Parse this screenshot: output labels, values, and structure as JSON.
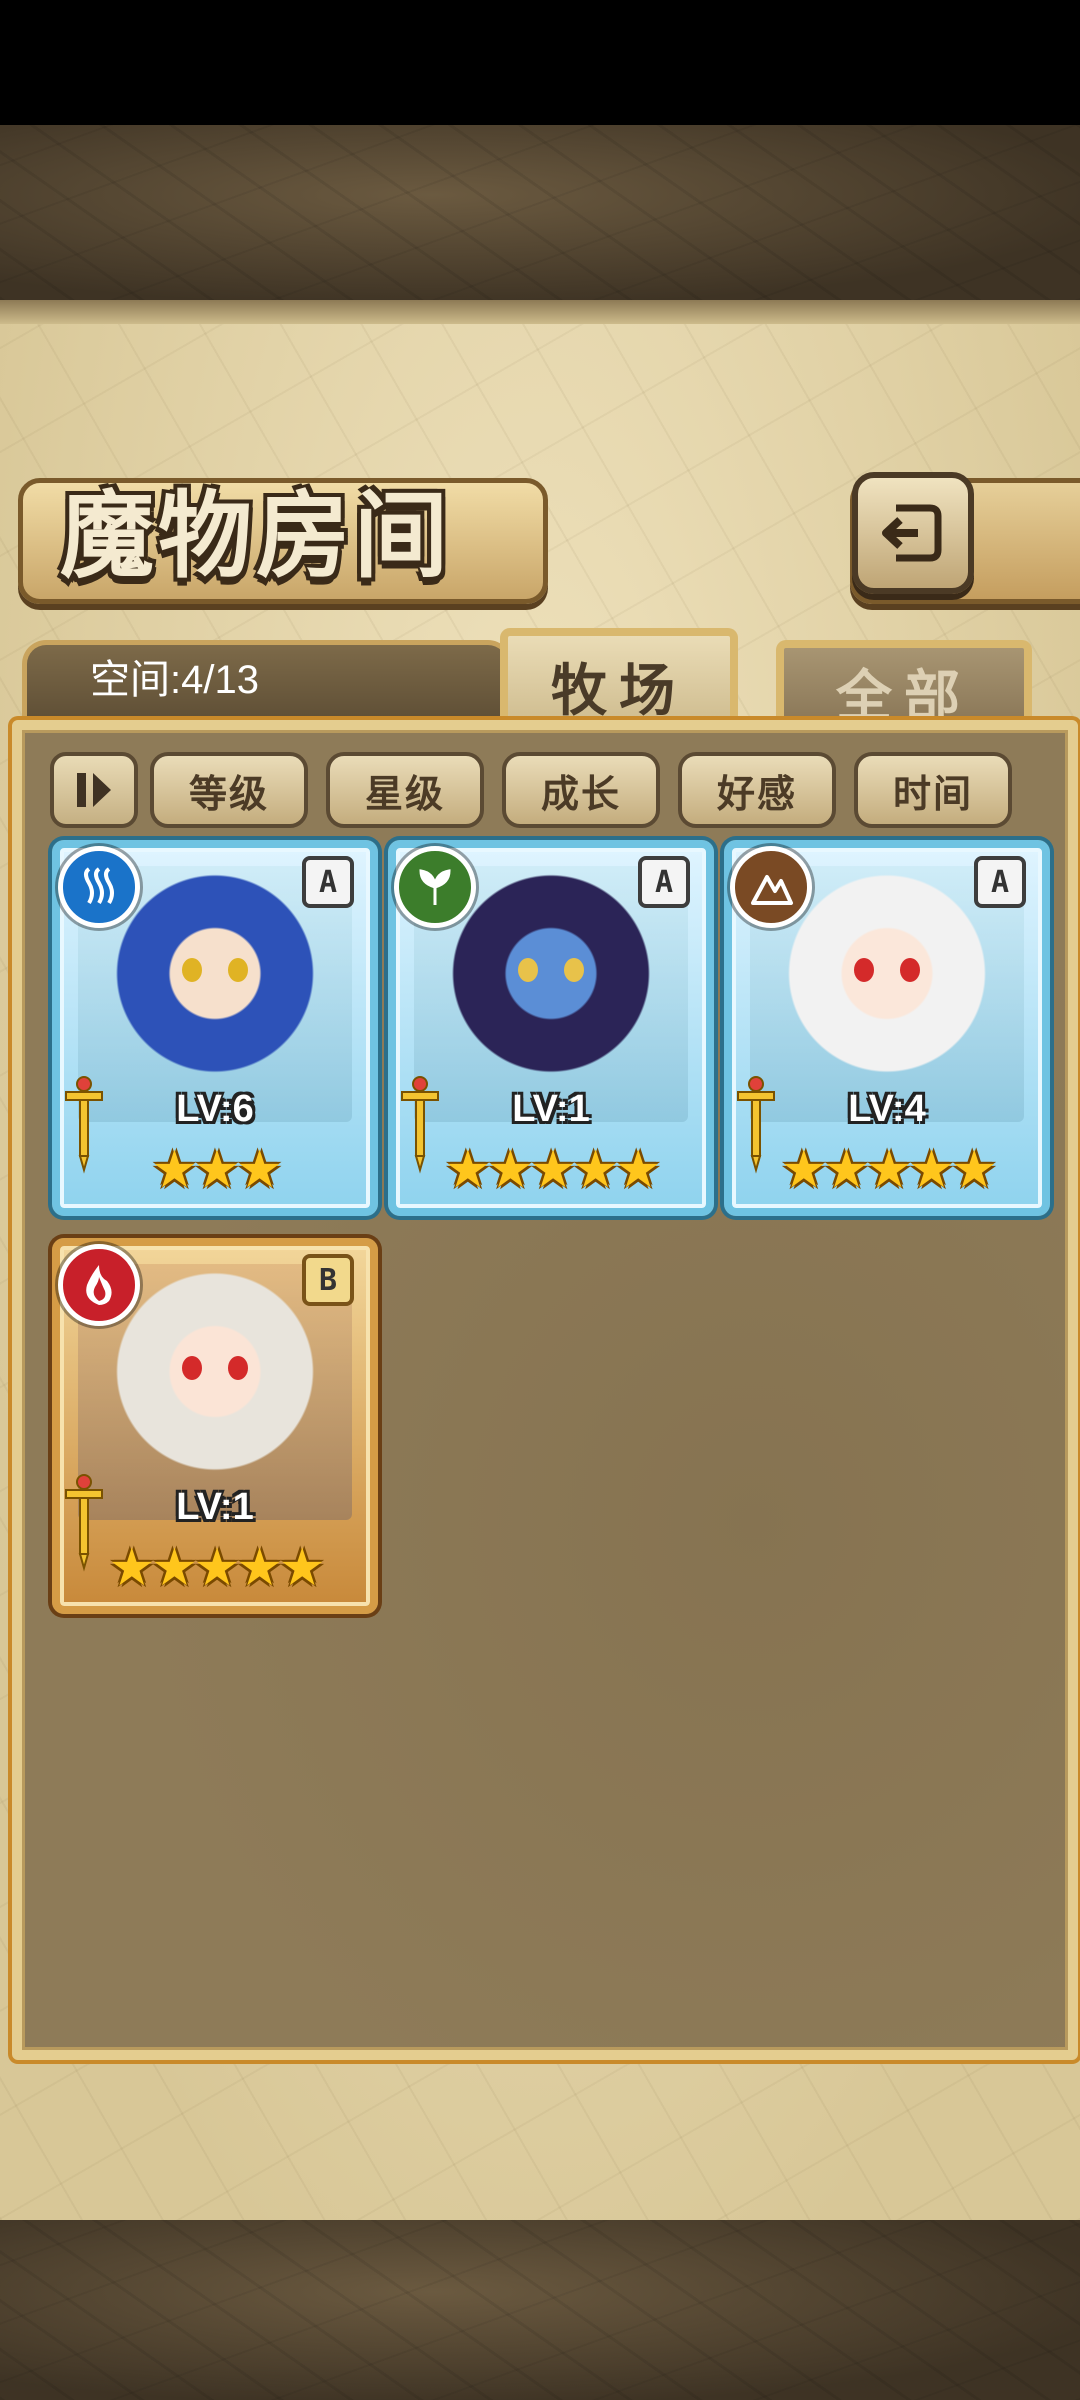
{
  "title": "魔物房间",
  "space_label": "空间:4/13",
  "tabs": [
    {
      "label": "牧场",
      "active": true
    },
    {
      "label": "全部",
      "active": false
    }
  ],
  "sort_buttons": [
    "等级",
    "星级",
    "成长",
    "好感",
    "时间"
  ],
  "monsters": [
    {
      "element": "water",
      "element_color": "#1a73c9",
      "rank": "A",
      "level": "LV:6",
      "stars": "★★★",
      "frame": "blue",
      "hair": "#2d52b8",
      "skin": "#f6e0cc"
    },
    {
      "element": "nature",
      "element_color": "#3c7d2b",
      "rank": "A",
      "level": "LV:1",
      "stars": "★★★★★",
      "frame": "blue",
      "hair": "#2b2457",
      "skin": "#5b8ed6"
    },
    {
      "element": "earth",
      "element_color": "#7a4a24",
      "rank": "A",
      "level": "LV:4",
      "stars": "★★★★★",
      "frame": "blue",
      "hair": "#f2f2f2",
      "skin": "#fbe7da"
    },
    {
      "element": "fire",
      "element_color": "#c8202a",
      "rank": "B",
      "level": "LV:1",
      "stars": "★★★★★",
      "frame": "gold",
      "hair": "#e8e4dc",
      "skin": "#fbe4d6"
    }
  ]
}
